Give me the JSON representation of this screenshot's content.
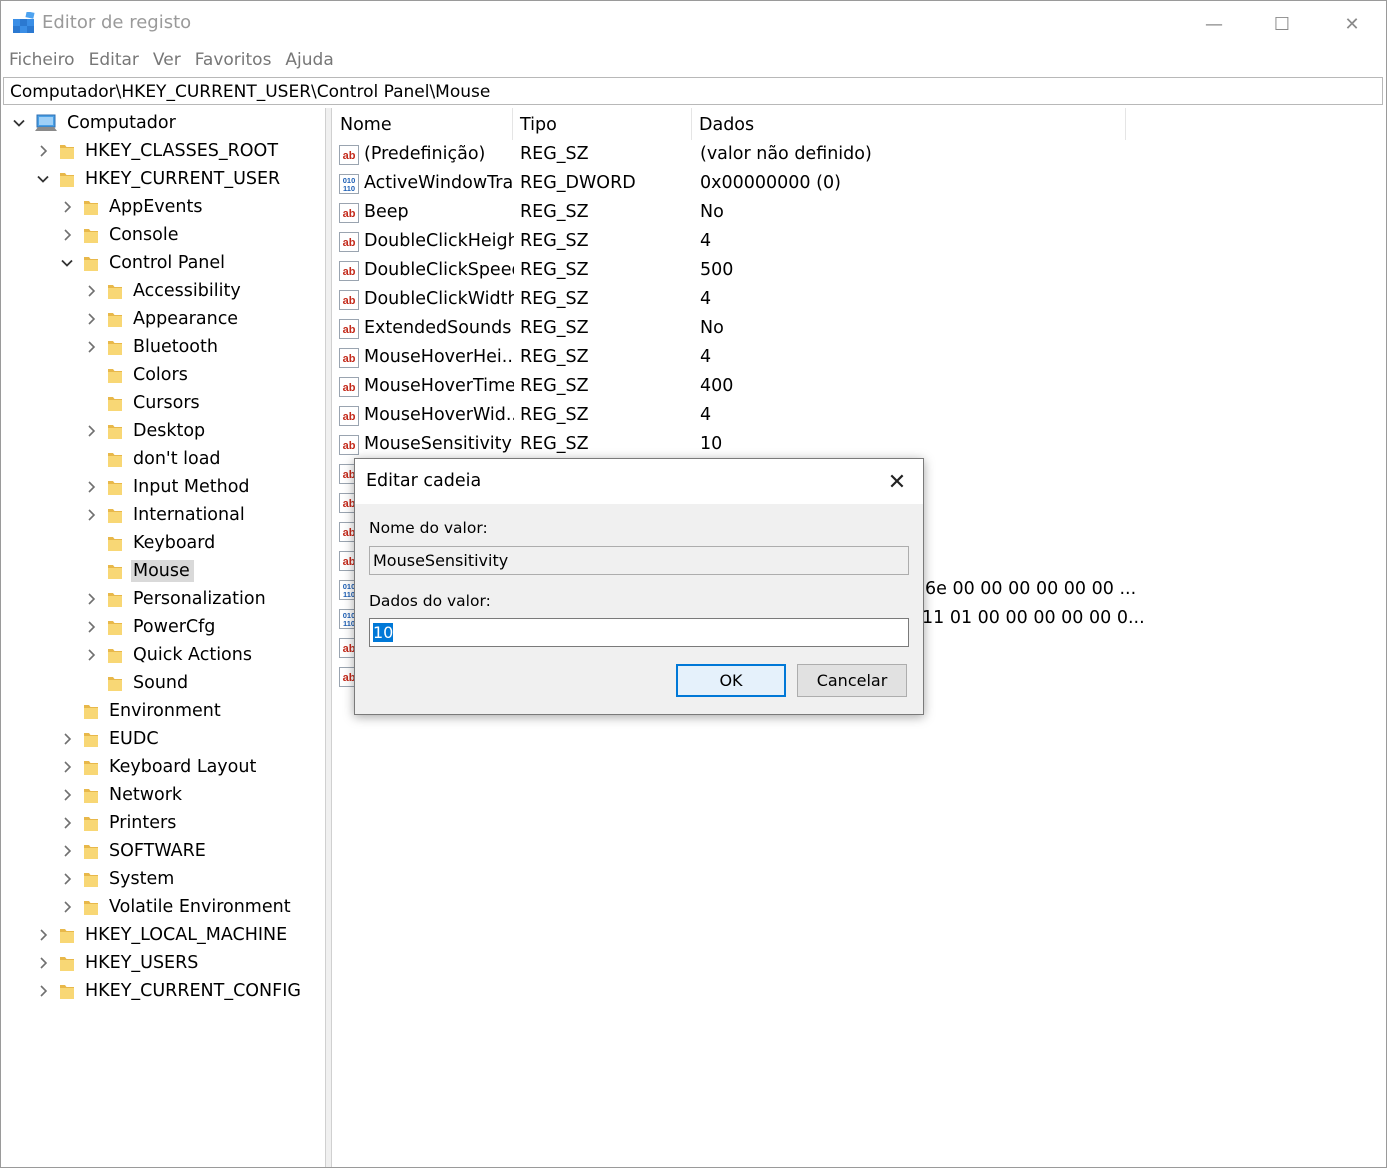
{
  "window": {
    "title": "Editor de registo",
    "minimize": "—",
    "maximize": "☐",
    "close": "✕"
  },
  "menu": [
    "Ficheiro",
    "Editar",
    "Ver",
    "Favoritos",
    "Ajuda"
  ],
  "address": "Computador\\HKEY_CURRENT_USER\\Control Panel\\Mouse",
  "tree": [
    {
      "label": "Computador",
      "depth": 0,
      "expander": "expanded",
      "icon": "computer-icon"
    },
    {
      "label": "HKEY_CLASSES_ROOT",
      "depth": 1,
      "expander": "collapsed",
      "icon": "folder-icon"
    },
    {
      "label": "HKEY_CURRENT_USER",
      "depth": 1,
      "expander": "expanded",
      "icon": "folder-icon"
    },
    {
      "label": "AppEvents",
      "depth": 2,
      "expander": "collapsed",
      "icon": "folder-icon"
    },
    {
      "label": "Console",
      "depth": 2,
      "expander": "collapsed",
      "icon": "folder-icon"
    },
    {
      "label": "Control Panel",
      "depth": 2,
      "expander": "expanded",
      "icon": "folder-icon"
    },
    {
      "label": "Accessibility",
      "depth": 3,
      "expander": "collapsed",
      "icon": "folder-icon"
    },
    {
      "label": "Appearance",
      "depth": 3,
      "expander": "collapsed",
      "icon": "folder-icon"
    },
    {
      "label": "Bluetooth",
      "depth": 3,
      "expander": "collapsed",
      "icon": "folder-icon"
    },
    {
      "label": "Colors",
      "depth": 3,
      "expander": "none",
      "icon": "folder-icon"
    },
    {
      "label": "Cursors",
      "depth": 3,
      "expander": "none",
      "icon": "folder-icon"
    },
    {
      "label": "Desktop",
      "depth": 3,
      "expander": "collapsed",
      "icon": "folder-icon"
    },
    {
      "label": "don't load",
      "depth": 3,
      "expander": "none",
      "icon": "folder-icon"
    },
    {
      "label": "Input Method",
      "depth": 3,
      "expander": "collapsed",
      "icon": "folder-icon"
    },
    {
      "label": "International",
      "depth": 3,
      "expander": "collapsed",
      "icon": "folder-icon"
    },
    {
      "label": "Keyboard",
      "depth": 3,
      "expander": "none",
      "icon": "folder-icon"
    },
    {
      "label": "Mouse",
      "depth": 3,
      "expander": "none",
      "icon": "folder-icon",
      "selected": true
    },
    {
      "label": "Personalization",
      "depth": 3,
      "expander": "collapsed",
      "icon": "folder-icon"
    },
    {
      "label": "PowerCfg",
      "depth": 3,
      "expander": "collapsed",
      "icon": "folder-icon"
    },
    {
      "label": "Quick Actions",
      "depth": 3,
      "expander": "collapsed",
      "icon": "folder-icon"
    },
    {
      "label": "Sound",
      "depth": 3,
      "expander": "none",
      "icon": "folder-icon"
    },
    {
      "label": "Environment",
      "depth": 2,
      "expander": "none",
      "icon": "folder-icon"
    },
    {
      "label": "EUDC",
      "depth": 2,
      "expander": "collapsed",
      "icon": "folder-icon"
    },
    {
      "label": "Keyboard Layout",
      "depth": 2,
      "expander": "collapsed",
      "icon": "folder-icon"
    },
    {
      "label": "Network",
      "depth": 2,
      "expander": "collapsed",
      "icon": "folder-icon"
    },
    {
      "label": "Printers",
      "depth": 2,
      "expander": "collapsed",
      "icon": "folder-icon"
    },
    {
      "label": "SOFTWARE",
      "depth": 2,
      "expander": "collapsed",
      "icon": "folder-icon"
    },
    {
      "label": "System",
      "depth": 2,
      "expander": "collapsed",
      "icon": "folder-icon"
    },
    {
      "label": "Volatile Environment",
      "depth": 2,
      "expander": "collapsed",
      "icon": "folder-icon"
    },
    {
      "label": "HKEY_LOCAL_MACHINE",
      "depth": 1,
      "expander": "collapsed",
      "icon": "folder-icon"
    },
    {
      "label": "HKEY_USERS",
      "depth": 1,
      "expander": "collapsed",
      "icon": "folder-icon"
    },
    {
      "label": "HKEY_CURRENT_CONFIG",
      "depth": 1,
      "expander": "collapsed",
      "icon": "folder-icon"
    }
  ],
  "list": {
    "columns": [
      "Nome",
      "Tipo",
      "Dados"
    ],
    "rows": [
      {
        "icon": "string-value-icon",
        "name": "(Predefinição)",
        "type": "REG_SZ",
        "data": "(valor não definido)"
      },
      {
        "icon": "binary-value-icon",
        "name": "ActiveWindowTra...",
        "type": "REG_DWORD",
        "data": "0x00000000 (0)"
      },
      {
        "icon": "string-value-icon",
        "name": "Beep",
        "type": "REG_SZ",
        "data": "No"
      },
      {
        "icon": "string-value-icon",
        "name": "DoubleClickHeight",
        "type": "REG_SZ",
        "data": "4"
      },
      {
        "icon": "string-value-icon",
        "name": "DoubleClickSpeed",
        "type": "REG_SZ",
        "data": "500"
      },
      {
        "icon": "string-value-icon",
        "name": "DoubleClickWidth",
        "type": "REG_SZ",
        "data": "4"
      },
      {
        "icon": "string-value-icon",
        "name": "ExtendedSounds",
        "type": "REG_SZ",
        "data": "No"
      },
      {
        "icon": "string-value-icon",
        "name": "MouseHoverHei...",
        "type": "REG_SZ",
        "data": "4"
      },
      {
        "icon": "string-value-icon",
        "name": "MouseHoverTime",
        "type": "REG_SZ",
        "data": "400"
      },
      {
        "icon": "string-value-icon",
        "name": "MouseHoverWid...",
        "type": "REG_SZ",
        "data": "4"
      },
      {
        "icon": "string-value-icon",
        "name": "MouseSensitivity",
        "type": "REG_SZ",
        "data": "10"
      },
      {
        "icon": "string-value-icon",
        "name": "",
        "type": "",
        "data": ""
      },
      {
        "icon": "string-value-icon",
        "name": "",
        "type": "",
        "data": ""
      },
      {
        "icon": "string-value-icon",
        "name": "",
        "type": "",
        "data": ""
      },
      {
        "icon": "string-value-icon",
        "name": "",
        "type": "",
        "data": ""
      },
      {
        "icon": "binary-value-icon",
        "name": "",
        "type": "",
        "data": "6e 00 00 00 00 00 00 ..."
      },
      {
        "icon": "binary-value-icon",
        "name": "",
        "type": "",
        "data": "11 01 00 00 00 00 00 0..."
      },
      {
        "icon": "string-value-icon",
        "name": "",
        "type": "",
        "data": ""
      },
      {
        "icon": "string-value-icon",
        "name": "",
        "type": "",
        "data": ""
      }
    ]
  },
  "dialog": {
    "title": "Editar cadeia",
    "close": "✕",
    "name_label": "Nome do valor:",
    "name_value": "MouseSensitivity",
    "data_label": "Dados do valor:",
    "data_value": "10",
    "ok_label": "OK",
    "cancel_label": "Cancelar"
  },
  "colors": {
    "selection": "#0078d7",
    "folder": "#f8d775",
    "string_icon_red": "#c42b1c",
    "binary_icon_blue": "#1d5fb5"
  }
}
